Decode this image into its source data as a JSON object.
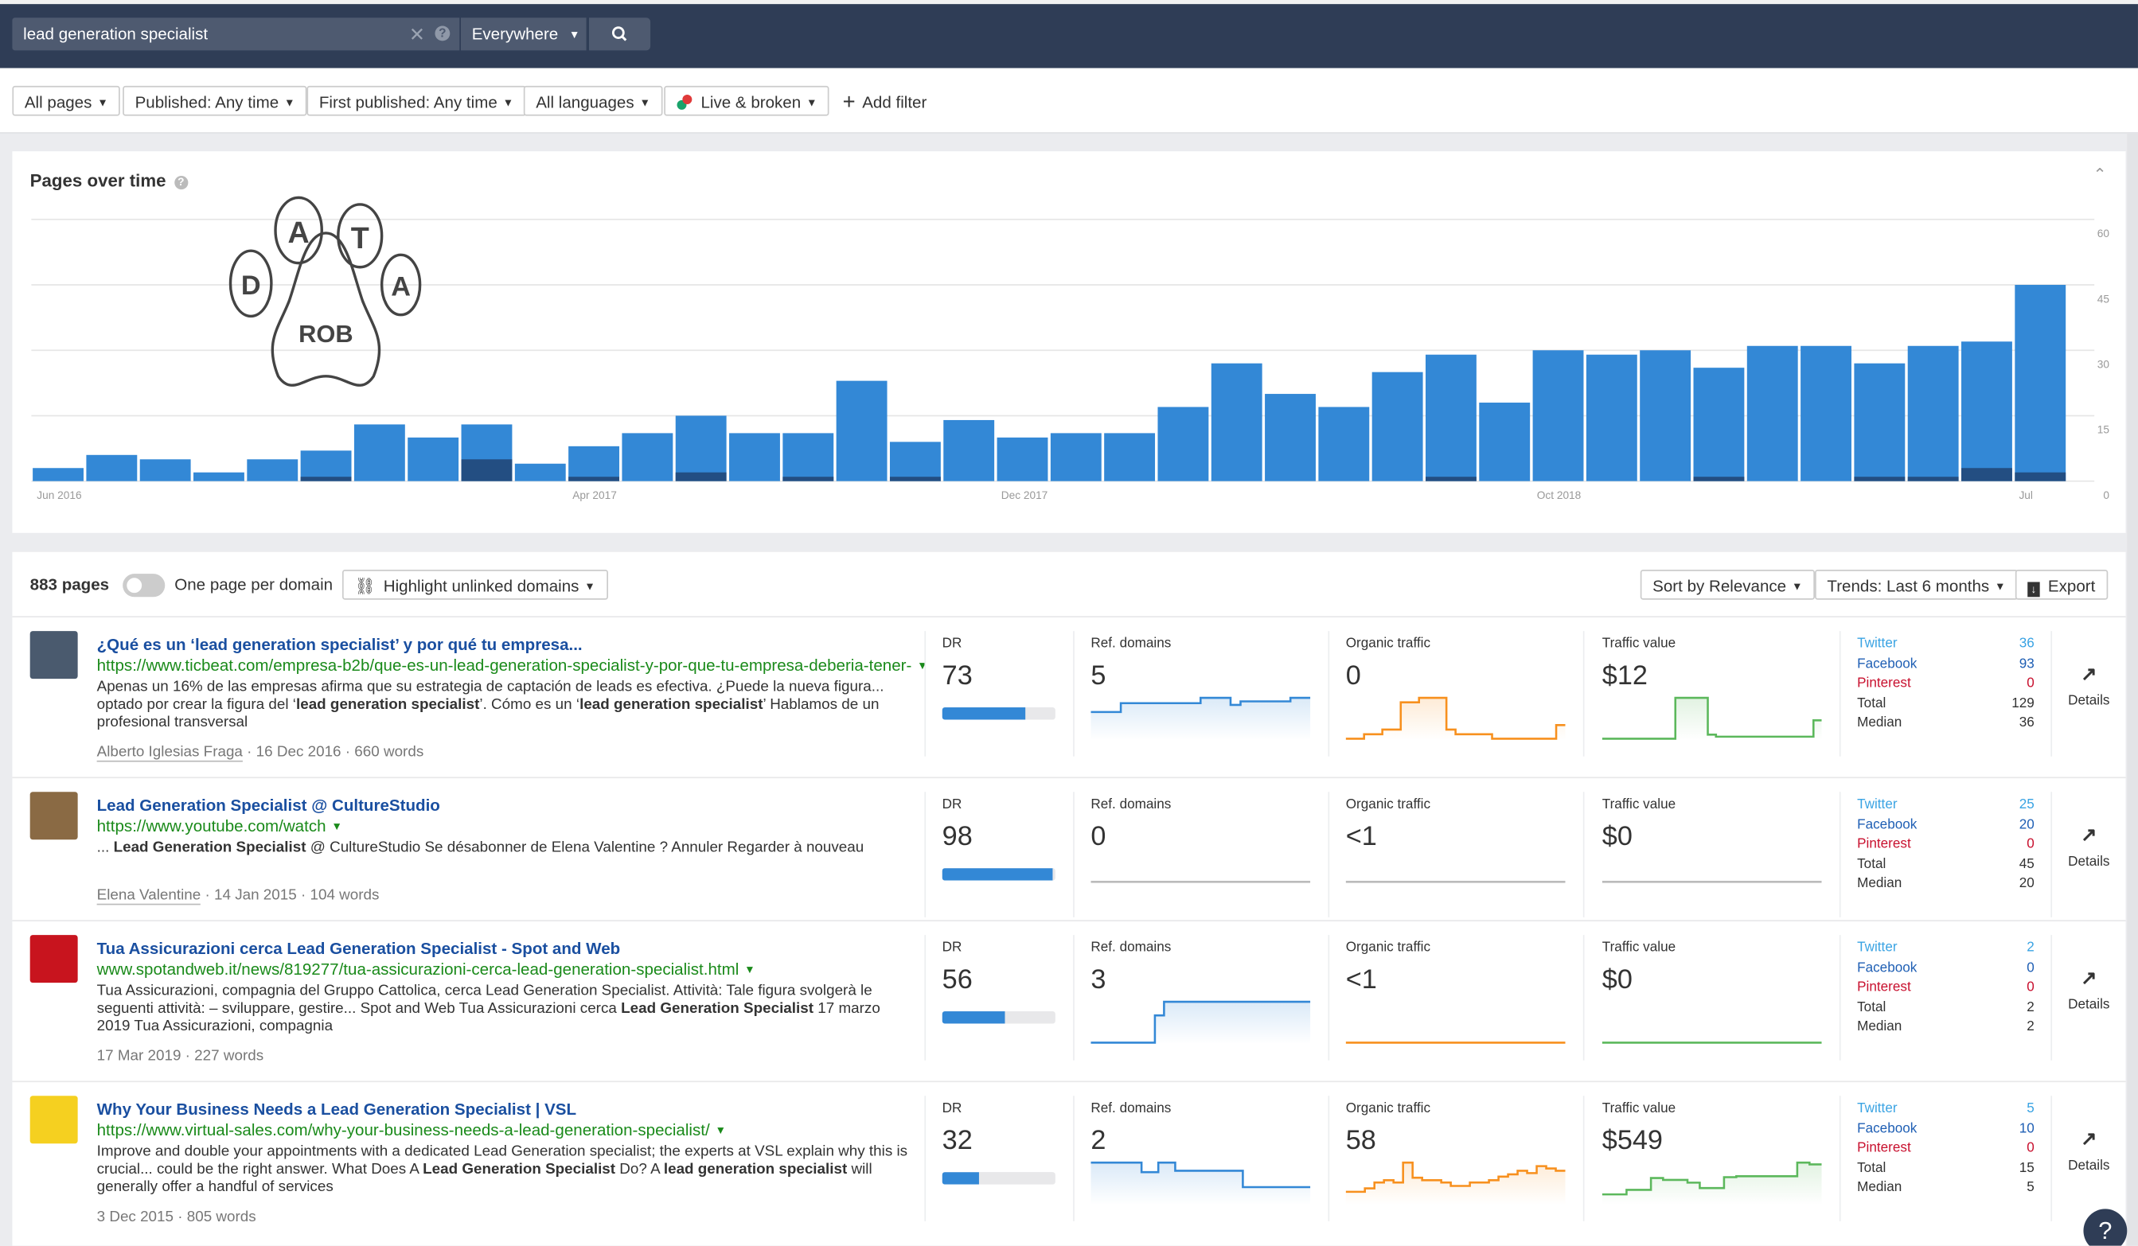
{
  "header": {
    "search_value": "lead generation specialist",
    "scope": "Everywhere",
    "icons": {
      "clear": "close-icon",
      "help": "question-icon",
      "search": "search-icon"
    }
  },
  "filters": [
    {
      "label": "All pages"
    },
    {
      "label": "Published: Any time"
    },
    {
      "label": "First published: Any time"
    },
    {
      "label": "All languages"
    },
    {
      "label": "Live & broken"
    },
    {
      "label": "Add filter"
    }
  ],
  "logo": {
    "letters": [
      "A",
      "T",
      "D",
      "A"
    ],
    "text": "ROB"
  },
  "chart_card": {
    "title": "Pages over time"
  },
  "chart_data": {
    "type": "bar",
    "title": "Pages over time",
    "stacked": true,
    "x": [
      "Jun 2016",
      "Jul 2016",
      "Aug 2016",
      "Sep 2016",
      "Oct 2016",
      "Nov 2016",
      "Dec 2016",
      "Jan 2017",
      "Feb 2017",
      "Mar 2017",
      "Apr 2017",
      "May 2017",
      "Jun 2017",
      "Jul 2017",
      "Aug 2017",
      "Sep 2017",
      "Oct 2017",
      "Nov 2017",
      "Dec 2017",
      "Jan 2018",
      "Feb 2018",
      "Mar 2018",
      "Apr 2018",
      "May 2018",
      "Jun 2018",
      "Jul 2018",
      "Aug 2018",
      "Sep 2018",
      "Oct 2018",
      "Nov 2018",
      "Dec 2018",
      "Jan 2019",
      "Feb 2019",
      "Mar 2019",
      "Apr 2019",
      "May 2019",
      "Jun 2019",
      "Jul 2019"
    ],
    "series": [
      {
        "color": "#234e82",
        "values": [
          0,
          0,
          0,
          0,
          0,
          1,
          0,
          0,
          5,
          0,
          1,
          0,
          2,
          0,
          1,
          0,
          1,
          0,
          0,
          0,
          0,
          0,
          0,
          0,
          0,
          0,
          1,
          0,
          0,
          0,
          0,
          1,
          0,
          0,
          1,
          1,
          3,
          2
        ]
      },
      {
        "color": "#3388d6",
        "values": [
          3,
          6,
          5,
          2,
          5,
          6,
          13,
          10,
          8,
          4,
          7,
          11,
          13,
          11,
          10,
          23,
          8,
          14,
          10,
          11,
          11,
          17,
          27,
          20,
          17,
          25,
          28,
          18,
          30,
          29,
          30,
          25,
          31,
          31,
          26,
          30,
          29,
          43
        ]
      }
    ],
    "x_tick_labels": [
      {
        "at": "Jun 2016",
        "label": "Jun 2016"
      },
      {
        "at": "Apr 2017",
        "label": "Apr 2017"
      },
      {
        "at": "Dec 2017",
        "label": "Dec 2017"
      },
      {
        "at": "Oct 2018",
        "label": "Oct 2018"
      },
      {
        "at": "Jul 2019",
        "label": "Jul"
      }
    ],
    "y_ticks": [
      "0",
      "15",
      "30",
      "45",
      "60"
    ],
    "ylim": [
      0,
      60
    ],
    "grid": true
  },
  "toolbar": {
    "count": "883 pages",
    "one_per_domain": "One page per domain",
    "one_per_domain_on": false,
    "highlight": "Highlight unlinked domains",
    "sort": "Sort by Relevance",
    "trends": "Trends: Last 6 months",
    "export": "Export"
  },
  "labels": {
    "dr": "DR",
    "ref": "Ref. domains",
    "organic": "Organic traffic",
    "value": "Traffic value",
    "twitter": "Twitter",
    "facebook": "Facebook",
    "pinterest": "Pinterest",
    "total": "Total",
    "median": "Median",
    "details": "Details"
  },
  "colors": {
    "twitter": "#3aa3e3",
    "facebook": "#1f5fb4",
    "pinterest": "#c8102e",
    "ref": "#3388d6",
    "organic": "#f7901e",
    "value": "#5cb85c"
  },
  "rows": [
    {
      "title": "¿Qué es un ‘lead generation specialist’ y por qué tu empresa...",
      "url": "https://www.ticbeat.com/empresa-b2b/que-es-un-lead-generation-specialist-y-por-que-tu-empresa-deberia-tener-",
      "snippet": [
        {
          "t": "Apenas un 16% de las empresas afirma que su estrategia de captación de leads es efectiva. ¿Puede la nueva figura... optado por crear la figura del ‘"
        },
        {
          "t": "lead generation specialist",
          "b": true
        },
        {
          "t": "’. Cómo es un ‘"
        },
        {
          "t": "lead generation specialist",
          "b": true
        },
        {
          "t": "’ Hablamos de un profesional transversal"
        }
      ],
      "author": "Alberto Iglesias Fraga",
      "date": "16 Dec 2016",
      "words": "660 words",
      "dr": "73",
      "dr_pct": 73,
      "ref": "5",
      "organic": "0",
      "value": "$12",
      "twitter": "36",
      "facebook": "93",
      "pinterest": "0",
      "total": "129",
      "median": "36",
      "trend_ref": [
        3,
        3,
        3,
        4,
        4,
        4,
        4,
        4,
        4,
        4,
        4,
        4.6,
        4.6,
        4.6,
        3.8,
        4.2,
        4.2,
        4.2,
        4.2,
        4.2,
        4.6,
        4.6
      ],
      "trend_organic": [
        0,
        0,
        0.5,
        0.5,
        1,
        1,
        4,
        4,
        4.5,
        4.5,
        4.5,
        1,
        0.5,
        0.5,
        0.5,
        0.5,
        0,
        0,
        0,
        0,
        0,
        0,
        0,
        1.5
      ],
      "trend_value": [
        0,
        0,
        0,
        0,
        0,
        0,
        0,
        0,
        0,
        1,
        1,
        1,
        1,
        0.1,
        0.05,
        0.05,
        0.05,
        0.05,
        0.05,
        0.05,
        0.05,
        0.05,
        0.05,
        0.05,
        0.05,
        0.05,
        0.45
      ],
      "thumb": "#4a5a6e"
    },
    {
      "title": "Lead Generation Specialist @ CultureStudio",
      "url": "https://www.youtube.com/watch",
      "snippet": [
        {
          "t": "... "
        },
        {
          "t": "Lead Generation Specialist",
          "b": true
        },
        {
          "t": " @ CultureStudio Se désabonner de Elena Valentine ? Annuler Regarder à nouveau"
        }
      ],
      "author": "Elena Valentine",
      "date": "14 Jan 2015",
      "words": "104 words",
      "dr": "98",
      "dr_pct": 98,
      "ref": "0",
      "organic": "<1",
      "value": "$0",
      "twitter": "25",
      "facebook": "20",
      "pinterest": "0",
      "total": "45",
      "median": "20",
      "trend_ref": [
        0,
        0
      ],
      "trend_organic": [
        0,
        0
      ],
      "trend_value": [
        0,
        0
      ],
      "thumb": "#8a6a44"
    },
    {
      "title": "Tua Assicurazioni cerca Lead Generation Specialist - Spot and Web",
      "url": "www.spotandweb.it/news/819277/tua-assicurazioni-cerca-lead-generation-specialist.html",
      "snippet": [
        {
          "t": "Tua Assicurazioni, compagnia del Gruppo Cattolica, cerca Lead Generation Specialist. Attività: Tale figura svolgerà le seguenti attività: – sviluppare, gestire... Spot and Web Tua Assicurazioni cerca "
        },
        {
          "t": "Lead Generation Specialist",
          "b": true
        },
        {
          "t": " 17 marzo 2019 Tua Assicurazioni, compagnia"
        }
      ],
      "author": "",
      "date": "17 Mar 2019",
      "words": "227 words",
      "dr": "56",
      "dr_pct": 56,
      "ref": "3",
      "organic": "<1",
      "value": "$0",
      "twitter": "2",
      "facebook": "0",
      "pinterest": "0",
      "total": "2",
      "median": "2",
      "trend_ref": [
        0,
        0,
        0,
        0,
        0,
        0,
        0,
        2,
        3,
        3,
        3,
        3,
        3,
        3,
        3,
        3,
        3,
        3,
        3,
        3,
        3,
        3,
        3,
        3
      ],
      "trend_organic": [
        0,
        0
      ],
      "trend_value": [
        0,
        0
      ],
      "thumb": "#c8141e"
    },
    {
      "title": "Why Your Business Needs a Lead Generation Specialist | VSL",
      "url": "https://www.virtual-sales.com/why-your-business-needs-a-lead-generation-specialist/",
      "snippet": [
        {
          "t": "Improve and double your appointments with a dedicated Lead Generation specialist; the experts at VSL explain why this is crucial... could be the right answer. What Does A "
        },
        {
          "t": "Lead Generation Specialist",
          "b": true
        },
        {
          "t": " Do? A "
        },
        {
          "t": "lead generation specialist",
          "b": true
        },
        {
          "t": " will generally offer a handful of services"
        }
      ],
      "author": "",
      "date": "3 Dec 2015",
      "words": "805 words",
      "dr": "32",
      "dr_pct": 32,
      "ref": "2",
      "organic": "58",
      "value": "$549",
      "twitter": "5",
      "facebook": "10",
      "pinterest": "0",
      "total": "15",
      "median": "5",
      "trend_ref": [
        3,
        3,
        3,
        3,
        3,
        3,
        2.3,
        2.3,
        3,
        3,
        2.4,
        2.4,
        2.4,
        2.4,
        2.4,
        2.4,
        2.4,
        2.4,
        1.2,
        1.2,
        1.2,
        1.2,
        1.2,
        1.2,
        1.2,
        1.2
      ],
      "trend_organic": [
        1,
        1,
        1.3,
        1.8,
        2,
        1.8,
        3.5,
        2.2,
        2,
        2,
        1.8,
        1.5,
        1.5,
        1.8,
        1.8,
        2,
        2.3,
        2.5,
        2.8,
        2.6,
        3.2,
        3,
        2.8
      ],
      "trend_value": [
        1,
        1,
        1.5,
        1.5,
        2.8,
        2.6,
        2.6,
        2.3,
        1.7,
        1.7,
        2.9,
        3,
        3,
        3,
        3,
        3,
        4.5,
        4.3
      ],
      "thumb": "#f5d020"
    }
  ],
  "help": "?"
}
